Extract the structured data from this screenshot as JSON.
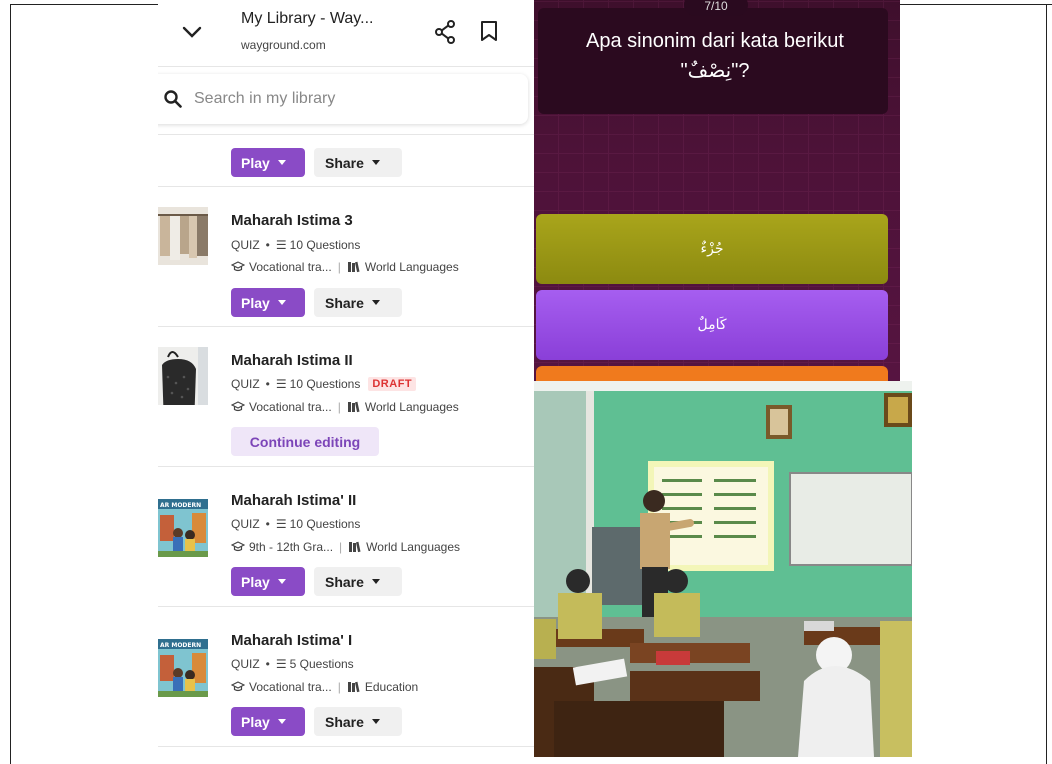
{
  "library": {
    "header": {
      "title": "My Library - Way...",
      "url": "wayground.com"
    },
    "search": {
      "placeholder": "Search in my library"
    },
    "play_label": "Play",
    "share_label": "Share",
    "continue_label": "Continue editing",
    "items": [
      {
        "title": "Maharah Istima 3",
        "type": "QUIZ",
        "questions": "10 Questions",
        "grade": "Vocational tra...",
        "subject": "World Languages"
      },
      {
        "title": "Maharah Istima II",
        "type": "QUIZ",
        "questions": "10 Questions",
        "badge": "DRAFT",
        "grade": "Vocational tra...",
        "subject": "World Languages"
      },
      {
        "title": "Maharah Istima' II",
        "type": "QUIZ",
        "questions": "10 Questions",
        "grade": "9th - 12th Gra...",
        "subject": "World Languages"
      },
      {
        "title": "Maharah Istima' I",
        "type": "QUIZ",
        "questions": "5 Questions",
        "grade": "Vocational tra...",
        "subject": "Education"
      }
    ],
    "thumb_label": "AR MODERN",
    "colors": {
      "accent": "#8a4bc6",
      "draft": "#d33333"
    }
  },
  "quiz": {
    "counter": "7/10",
    "question": "Apa sinonim dari kata berikut \"نِصْفٌ\"?",
    "options": [
      "جُزْءٌ",
      "كَامِلٌ"
    ],
    "colors": {
      "option1": "#a9a51b",
      "option2": "#a65ef0",
      "option3": "#f07a1d"
    }
  }
}
